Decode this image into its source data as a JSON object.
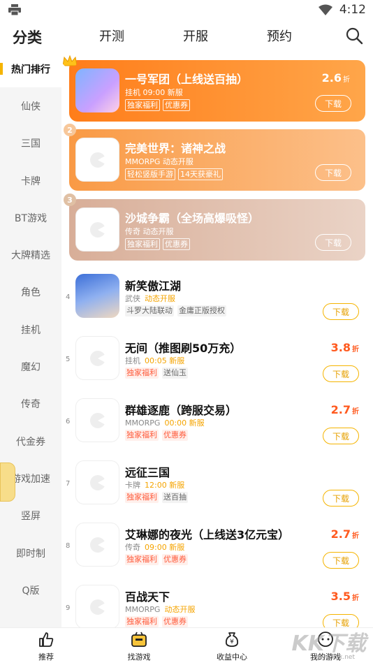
{
  "status_bar": {
    "time": "4:12",
    "left_icon": "print-icon",
    "wifi_icon": "wifi-icon",
    "battery_icon": "battery-icon"
  },
  "top_tabs": [
    "分类",
    "开测",
    "开服",
    "预约"
  ],
  "sidebar": [
    "热门排行",
    "仙侠",
    "三国",
    "卡牌",
    "BT游戏",
    "大牌精选",
    "角色",
    "挂机",
    "魔幻",
    "传奇",
    "代金券",
    "游戏加速",
    "竖屏",
    "即时制",
    "Q版"
  ],
  "top_cards": [
    {
      "rank": "1",
      "name": "一号军团（上线送百抽）",
      "meta": "挂机  09:00 新服",
      "tags": [
        "独家福利",
        "优惠券"
      ],
      "discount": "2.6",
      "discount_unit": "折",
      "download": "下载"
    },
    {
      "rank": "2",
      "name": "完美世界：诸神之战",
      "meta": "MMORPG  动态开服",
      "tags": [
        "轻松竖版手游",
        "14天获豪礼"
      ],
      "download": "下载"
    },
    {
      "rank": "3",
      "name": "沙城争霸（全场高爆吸怪）",
      "meta": "传奇  动态开服",
      "tags": [
        "独家福利",
        "优惠券"
      ],
      "download": "下载"
    }
  ],
  "list": [
    {
      "rank": "4",
      "name": "新笑傲江湖",
      "genre": "武侠",
      "server": "动态开服",
      "tags": [
        {
          "text": "斗罗大陆联动",
          "style": "gray"
        },
        {
          "text": "金庸正版授权",
          "style": "gray"
        }
      ],
      "download": "下载"
    },
    {
      "rank": "5",
      "name": "无间（推图刷50万充）",
      "genre": "挂机",
      "server": "00:05 新服",
      "tags": [
        {
          "text": "独家福利",
          "style": "hot"
        },
        {
          "text": "送仙玉",
          "style": "gray"
        }
      ],
      "discount": "3.8",
      "discount_unit": "折",
      "download": "下载"
    },
    {
      "rank": "6",
      "name": "群雄逐鹿（跨服交易）",
      "genre": "MMORPG",
      "server": "00:00 新服",
      "tags": [
        {
          "text": "独家福利",
          "style": "hot"
        },
        {
          "text": "优惠券",
          "style": "hot"
        }
      ],
      "discount": "2.7",
      "discount_unit": "折",
      "download": "下载"
    },
    {
      "rank": "7",
      "name": "远征三国",
      "genre": "卡牌",
      "server": "12:00 新服",
      "tags": [
        {
          "text": "独家福利",
          "style": "hot"
        },
        {
          "text": "送百抽",
          "style": "gray"
        }
      ],
      "download": "下载"
    },
    {
      "rank": "8",
      "name": "艾琳娜的夜光（上线送3亿元宝）",
      "genre": "传奇",
      "server": "09:00 新服",
      "tags": [
        {
          "text": "独家福利",
          "style": "hot"
        },
        {
          "text": "优惠券",
          "style": "hot"
        }
      ],
      "discount": "2.7",
      "discount_unit": "折",
      "download": "下载"
    },
    {
      "rank": "9",
      "name": "百战天下",
      "genre": "MMORPG",
      "server": "动态开服",
      "tags": [
        {
          "text": "独家福利",
          "style": "hot"
        },
        {
          "text": "优惠券",
          "style": "hot"
        }
      ],
      "discount": "3.5",
      "discount_unit": "折",
      "download": "下载"
    }
  ],
  "bottom_nav": [
    "推荐",
    "找游戏",
    "收益中心",
    "我的游戏"
  ],
  "watermark": {
    "main": "KK下载",
    "sub": "www.kkx.net"
  },
  "colors": {
    "accent": "#f5b400",
    "card1": "#ff8a1f",
    "card2": "#f7a85a",
    "card3": "#d9b3a0",
    "discount": "#ff5a1f"
  }
}
